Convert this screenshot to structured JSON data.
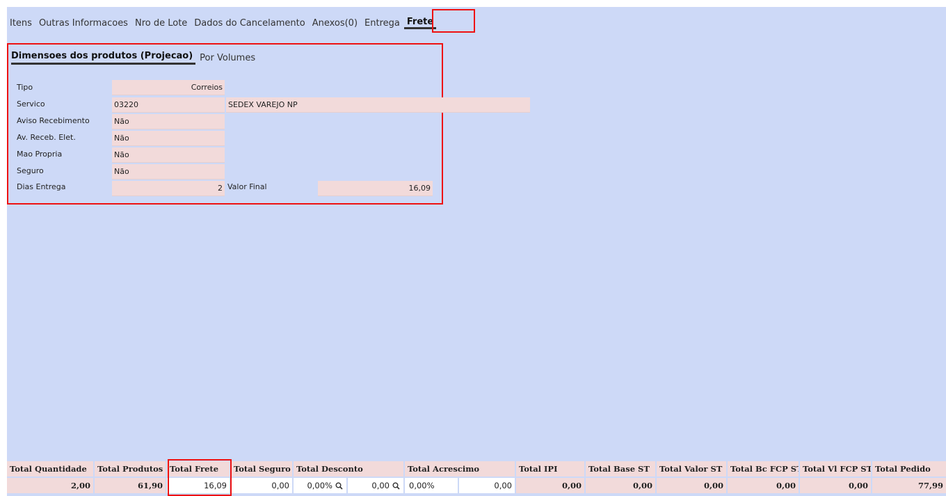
{
  "tabs": [
    {
      "label": "Itens"
    },
    {
      "label": "Outras Informacoes"
    },
    {
      "label": "Nro de Lote"
    },
    {
      "label": "Dados do Cancelamento"
    },
    {
      "label": "Anexos(0)"
    },
    {
      "label": "Entrega"
    },
    {
      "label": "Frete"
    }
  ],
  "subtabs": [
    {
      "label": "Dimensoes dos produtos (Projecao)"
    },
    {
      "label": "Por Volumes"
    }
  ],
  "form": {
    "tipo_label": "Tipo",
    "tipo_value": "Correios",
    "servico_label": "Servico",
    "servico_code": "03220",
    "servico_desc": "SEDEX VAREJO NP",
    "aviso_label": "Aviso Recebimento",
    "aviso_value": "Não",
    "av_eletr_label": "Av. Receb. Elet.",
    "av_eletr_value": "Não",
    "mao_label": "Mao Propria",
    "mao_value": "Não",
    "seguro_label": "Seguro",
    "seguro_value": "Não",
    "dias_label": "Dias Entrega",
    "dias_value": "2",
    "valor_final_label": "Valor Final",
    "valor_final_value": "16,09"
  },
  "totals": {
    "headers": {
      "quantidade": "Total Quantidade",
      "produtos": "Total Produtos",
      "frete": "Total Frete",
      "seguro": "Total Seguro",
      "desconto": "Total Desconto",
      "acrescimo": "Total Acrescimo",
      "ipi": "Total IPI",
      "base_st": "Total Base ST",
      "valor_st": "Total Valor ST",
      "bc_fcp_st": "Total Bc FCP ST",
      "vl_fcp_st": "Total Vl FCP ST",
      "pedido": "Total Pedido"
    },
    "values": {
      "quantidade": "2,00",
      "produtos": "61,90",
      "frete": "16,09",
      "seguro": "0,00",
      "desconto_pct": "0,00%",
      "desconto_val": "0,00",
      "acrescimo_pct": "0,00%",
      "acrescimo_val": "0,00",
      "ipi": "0,00",
      "base_st": "0,00",
      "valor_st": "0,00",
      "bc_fcp_st": "0,00",
      "vl_fcp_st": "0,00",
      "pedido": "77,99"
    }
  },
  "icons": {
    "search": "magnifier-icon"
  },
  "colors": {
    "background": "#cdd9f7",
    "field": "#f2dada",
    "highlight": "#e11111"
  }
}
